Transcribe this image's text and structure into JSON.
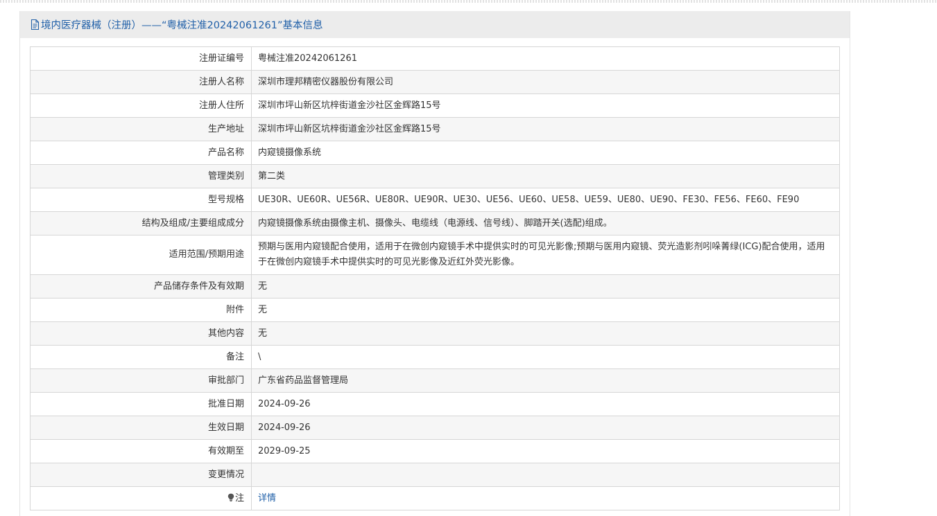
{
  "header": {
    "title": "境内医疗器械（注册）——“粤械注准20242061261”基本信息",
    "icon": "document-icon",
    "accent_color": "#1f5fa8"
  },
  "rows": [
    {
      "label": "注册证编号",
      "value": "粤械注准20242061261"
    },
    {
      "label": "注册人名称",
      "value": "深圳市理邦精密仪器股份有限公司"
    },
    {
      "label": "注册人住所",
      "value": "深圳市坪山新区坑梓街道金沙社区金辉路15号"
    },
    {
      "label": "生产地址",
      "value": "深圳市坪山新区坑梓街道金沙社区金辉路15号"
    },
    {
      "label": "产品名称",
      "value": "内窥镜摄像系统"
    },
    {
      "label": "管理类别",
      "value": "第二类"
    },
    {
      "label": "型号规格",
      "value": "UE30R、UE60R、UE56R、UE80R、UE90R、UE30、UE56、UE60、UE58、UE59、UE80、UE90、FE30、FE56、FE60、FE90"
    },
    {
      "label": "结构及组成/主要组成成分",
      "value": "内窥镜摄像系统由摄像主机、摄像头、电缆线（电源线、信号线）、脚踏开关(选配)组成。"
    },
    {
      "label": "适用范围/预期用途",
      "value": "预期与医用内窥镜配合使用，适用于在微创内窥镜手术中提供实时的可见光影像;预期与医用内窥镜、荧光造影剂吲哚菁绿(ICG)配合使用，适用于在微创内窥镜手术中提供实时的可见光影像及近红外荧光影像。"
    },
    {
      "label": "产品储存条件及有效期",
      "value": "无"
    },
    {
      "label": "附件",
      "value": "无"
    },
    {
      "label": "其他内容",
      "value": "无"
    },
    {
      "label": "备注",
      "value": "\\"
    },
    {
      "label": "审批部门",
      "value": "广东省药品监督管理局"
    },
    {
      "label": "批准日期",
      "value": "2024-09-26"
    },
    {
      "label": "生效日期",
      "value": "2024-09-26"
    },
    {
      "label": "有效期至",
      "value": "2029-09-25"
    },
    {
      "label": "变更情况",
      "value": ""
    }
  ],
  "note_row": {
    "icon": "lightbulb-icon",
    "label": "注",
    "link_text": "详情"
  }
}
